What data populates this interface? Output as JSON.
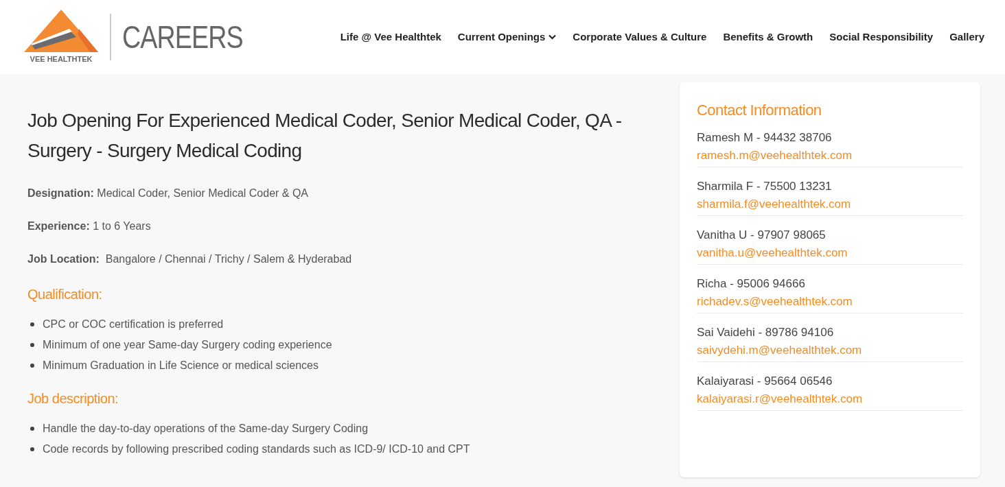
{
  "logo": {
    "brand": "VEE HEALTHTEK",
    "title": "CAREERS"
  },
  "nav": [
    {
      "label": "Life @ Vee Healthtek",
      "dropdown": false
    },
    {
      "label": "Current Openings",
      "dropdown": true
    },
    {
      "label": "Corporate Values & Culture",
      "dropdown": false
    },
    {
      "label": "Benefits & Growth",
      "dropdown": false
    },
    {
      "label": "Social Responsibility",
      "dropdown": false
    },
    {
      "label": "Gallery",
      "dropdown": false
    }
  ],
  "job": {
    "title": "Job Opening For Experienced Medical Coder, Senior Medical Coder, QA - Surgery - Surgery Medical Coding",
    "details": [
      "**Designation:** Medical Coder, Senior Medical Coder & QA",
      "**Experience:** 1 to 6 Years",
      "**Job Location:**  Bangalore / Chennai / Trichy / Salem & Hyderabad"
    ],
    "sections": [
      {
        "heading": "Qualification:",
        "items": [
          "CPC or COC certification is preferred",
          "Minimum of one year Same-day Surgery coding experience",
          "Minimum Graduation in Life Science or medical sciences"
        ]
      },
      {
        "heading": "Job description:",
        "items": [
          "Handle the day-to-day operations of the Same-day Surgery Coding",
          "Code records by following prescribed coding standards such as ICD-9/ ICD-10 and CPT"
        ]
      }
    ]
  },
  "contact": {
    "heading": "Contact Information",
    "people": [
      {
        "name": "Ramesh M - 94432 38706",
        "email": "ramesh.m@veehealthtek.com"
      },
      {
        "name": "Sharmila F - 75500 13231",
        "email": "sharmila.f@veehealthtek.com"
      },
      {
        "name": "Vanitha U - 97907 98065",
        "email": "vanitha.u@veehealthtek.com"
      },
      {
        "name": "Richa - 95006 94666",
        "email": "richadev.s@veehealthtek.com"
      },
      {
        "name": "Sai Vaidehi - 89786 94106",
        "email": "saivydehi.m@veehealthtek.com"
      },
      {
        "name": "Kalaiyarasi - 95664 06546",
        "email": "kalaiyarasi.r@veehealthtek.com"
      }
    ]
  }
}
